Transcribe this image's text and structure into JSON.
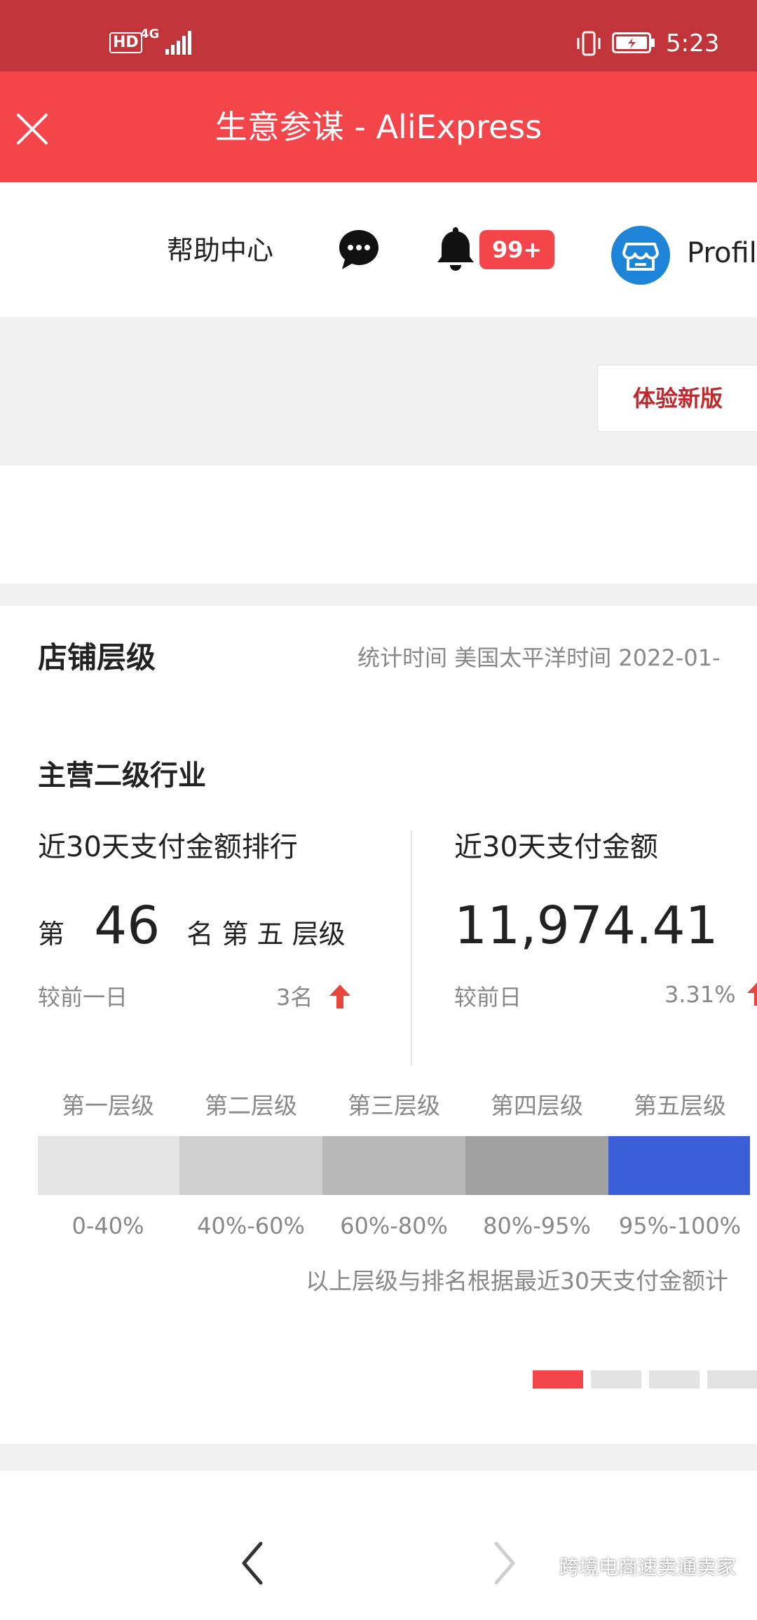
{
  "status_bar": {
    "hd": "HD",
    "network": "4G",
    "time": "5:23"
  },
  "title_bar": {
    "title": "生意参谋 - AliExpress"
  },
  "top_nav": {
    "help": "帮助中心",
    "badge": "99+",
    "profile": "Profil"
  },
  "new_version_button": "体验新版",
  "card": {
    "title": "店铺层级",
    "stat_time": "统计时间 美国太平洋时间 2022-01-",
    "subheading": "主营二级行业",
    "left_metric": {
      "label": "近30天支付金额排行",
      "prefix": "第",
      "rank": "46",
      "suffix": "名 第 五 层级",
      "compare_label": "较前一日",
      "compare_value": "3名"
    },
    "right_metric": {
      "label": "近30天支付金额",
      "value": "11,974.41",
      "compare_label": "较前日",
      "compare_value": "3.31%"
    },
    "levels": [
      {
        "label": "第一层级",
        "range": "0-40%",
        "color": "#e4e4e4"
      },
      {
        "label": "第二层级",
        "range": "40%-60%",
        "color": "#cfcfcf"
      },
      {
        "label": "第三层级",
        "range": "60%-80%",
        "color": "#b8b8b8"
      },
      {
        "label": "第四层级",
        "range": "80%-95%",
        "color": "#a1a1a1"
      },
      {
        "label": "第五层级",
        "range": "95%-100%",
        "color": "#3a5fd6"
      }
    ],
    "note": "以上层级与排名根据最近30天支付金额计"
  },
  "watermark": "跨境电商速卖通卖家",
  "colors": {
    "status_bar": "#c0343a",
    "title_bar": "#f4454b",
    "accent_red": "#e8453c",
    "level_active": "#3a5fd6"
  }
}
